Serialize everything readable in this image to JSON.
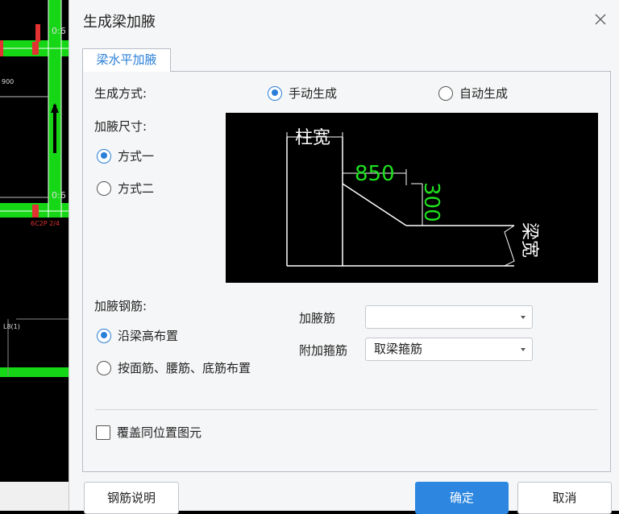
{
  "background": {
    "cad_texts": [
      "0:6",
      "0:6",
      "900",
      "6C2P 2/4",
      "L8(1)"
    ]
  },
  "dialog": {
    "title": "生成梁加腋",
    "close_icon": "close-icon",
    "tab_label": "梁水平加腋",
    "generation": {
      "label": "生成方式:",
      "options": [
        {
          "label": "手动生成",
          "selected": true
        },
        {
          "label": "自动生成",
          "selected": false
        }
      ]
    },
    "size": {
      "label": "加腋尺寸:",
      "options": [
        {
          "label": "方式一",
          "selected": true
        },
        {
          "label": "方式二",
          "selected": false
        }
      ]
    },
    "preview": {
      "column_width_label": "柱宽",
      "length_value": "850",
      "height_value": "300",
      "beam_width_label": "梁宽"
    },
    "rebar": {
      "label": "加腋钢筋:",
      "options": [
        {
          "label": "沿梁高布置",
          "selected": true
        },
        {
          "label": "按面筋、腰筋、底筋布置",
          "selected": false
        }
      ],
      "haunch_bar_label": "加腋筋",
      "haunch_bar_value": "",
      "stirrup_label": "附加箍筋",
      "stirrup_value": "取梁箍筋"
    },
    "overwrite_label": "覆盖同位置图元",
    "overwrite_checked": false,
    "buttons": {
      "help": "钢筋说明",
      "ok": "确定",
      "cancel": "取消"
    }
  }
}
